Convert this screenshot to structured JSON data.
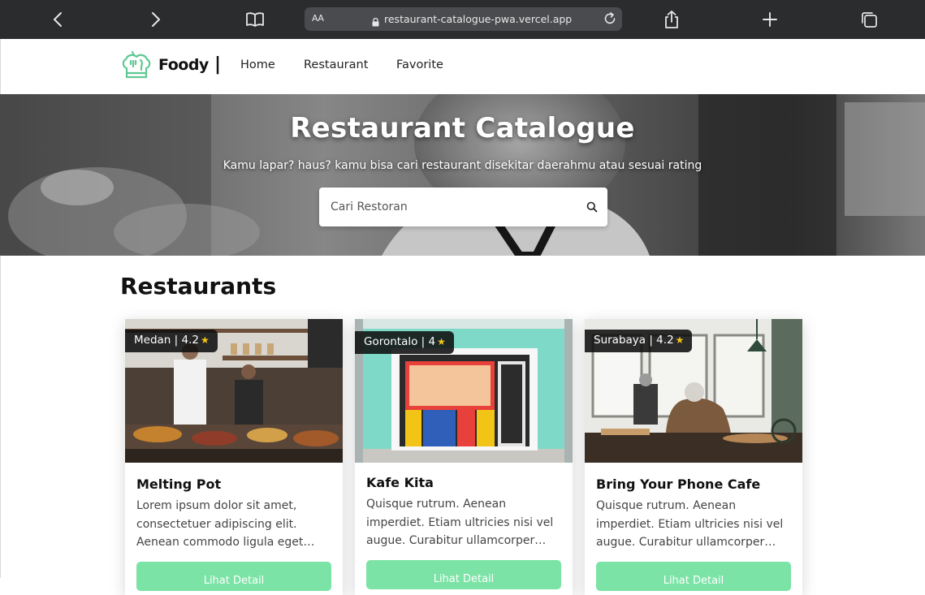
{
  "browser": {
    "reader_label": "AA",
    "url": "restaurant-catalogue-pwa.vercel.app"
  },
  "nav": {
    "brand": "Foody",
    "separator": "|",
    "links": [
      "Home",
      "Restaurant",
      "Favorite"
    ]
  },
  "hero": {
    "title": "Restaurant Catalogue",
    "subtitle": "Kamu lapar? haus? kamu bisa cari restaurant disekitar daerahmu atau sesuai rating",
    "search_placeholder": "Cari Restoran"
  },
  "section": {
    "title": "Restaurants"
  },
  "restaurants": [
    {
      "city_rating": "Medan | 4.2",
      "name": "Melting Pot",
      "description": "Lorem ipsum dolor sit amet, consectetuer adipiscing elit. Aenean commodo ligula eget…",
      "button": "Lihat Detail"
    },
    {
      "city_rating": "Gorontalo | 4",
      "name": "Kafe Kita",
      "description": "Quisque rutrum. Aenean imperdiet. Etiam ultricies nisi vel augue. Curabitur ullamcorper…",
      "button": "Lihat Detail"
    },
    {
      "city_rating": "Surabaya | 4.2",
      "name": "Bring Your Phone Cafe",
      "description": "Quisque rutrum. Aenean imperdiet. Etiam ultricies nisi vel augue. Curabitur ullamcorper…",
      "button": "Lihat Detail"
    }
  ],
  "colors": {
    "accent_button": "#7be3a5",
    "logo_green": "#5ec992",
    "star": "#f5c518"
  }
}
